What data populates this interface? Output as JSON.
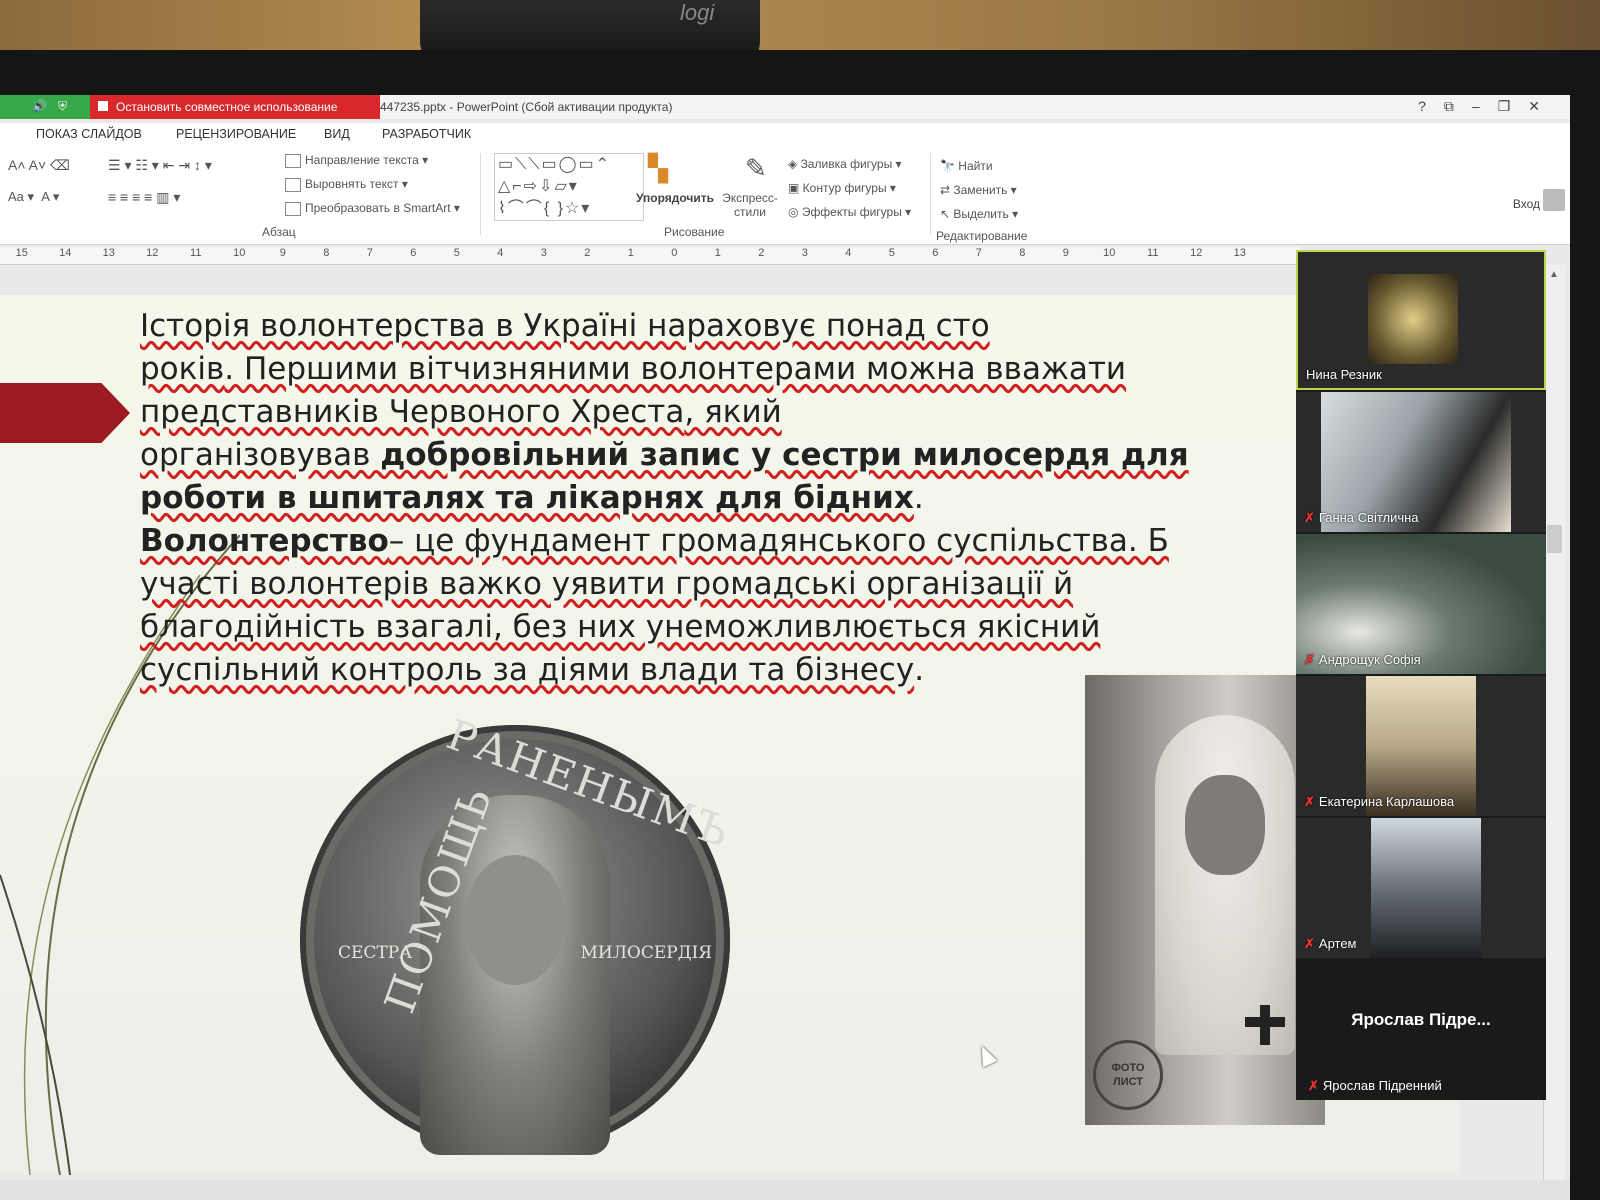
{
  "webcam_logo": "logi",
  "screen_share": {
    "stop_label": "Остановить совместное использование"
  },
  "window": {
    "title": "447235.pptx - PowerPoint (Сбой активации продукта)",
    "controls": [
      "?",
      "⧉",
      "–",
      "❐",
      "✕"
    ],
    "sign_in": "Вход"
  },
  "ribbon_tabs": [
    "ПОКАЗ СЛАЙДОВ",
    "РЕЦЕНЗИРОВАНИЕ",
    "ВИД",
    "РАЗРАБОТЧИК"
  ],
  "ribbon": {
    "paragraph": {
      "items": [
        "Направление текста",
        "Выровнять текст",
        "Преобразовать в SmartArt"
      ],
      "group": "Абзац"
    },
    "drawing": {
      "arrange": "Упорядочить",
      "quick_styles": "Экспресс-стили",
      "items": [
        "Заливка фигуры",
        "Контур фигуры",
        "Эффекты фигуры"
      ],
      "group": "Рисование"
    },
    "editing": {
      "items": [
        "Найти",
        "Заменить",
        "Выделить"
      ],
      "group": "Редактирование"
    }
  },
  "ruler_ticks": [
    "15",
    "14",
    "13",
    "12",
    "11",
    "10",
    "9",
    "8",
    "7",
    "6",
    "5",
    "4",
    "3",
    "2",
    "1",
    "0",
    "1",
    "2",
    "3",
    "4",
    "5",
    "6",
    "7",
    "8",
    "9",
    "10",
    "11",
    "12",
    "13"
  ],
  "slide": {
    "p1_a": "Історія волонтерства в Україні нараховує понад сто",
    "p1_b": "років",
    "p1_c": ". Першими вітчизняними волонтерами можна вважати",
    "p1_d": "представників Червоного Хреста",
    "p1_e": ", який",
    "p1_f": "організовував ",
    "p1_bold": "добровільний запис у сестри милосердя для роботи в шпиталях та лікарнях для бідних",
    "p1_end": ".",
    "p2_bold": "Волонтерство",
    "p2_a": "– це фундамент громадянського суспільства. Б",
    "p2_b": "участі волонтерів важко уявити громадські організації й",
    "p2_c": "благодійність взагалі, без них унеможливлюється якісний",
    "p2_d": "суспільний контроль за діями влади та бізнесу",
    "p2_end": ".",
    "medal": {
      "top": "РАНЕНЫМЪ",
      "left": "ПОМОЩЬ",
      "left2": "СЕСТРА",
      "right2": "МИЛОСЕРДІЯ"
    },
    "stamp": "ФОТО ЛИСТ"
  },
  "participants": [
    {
      "name": "Нина Резник",
      "muted": false
    },
    {
      "name": "Ганна Світлична",
      "muted": true
    },
    {
      "name": "Андрощук Софія",
      "muted": true
    },
    {
      "name": "Екатерина Карлашова",
      "muted": true
    },
    {
      "name": "Артем",
      "muted": true
    },
    {
      "name": "Ярослав Підренний",
      "display": "Ярослав  Підре...",
      "muted": true
    }
  ],
  "colors": {
    "share_green": "#36a84a",
    "share_red": "#d8282c",
    "arrow": "#9b1b20",
    "active_speaker": "#b7d64a",
    "mute_icon": "#e33333"
  },
  "icons": [
    "speaker-icon",
    "shield-icon",
    "stop-icon",
    "mute-mic-icon",
    "mouse-cursor-icon"
  ]
}
